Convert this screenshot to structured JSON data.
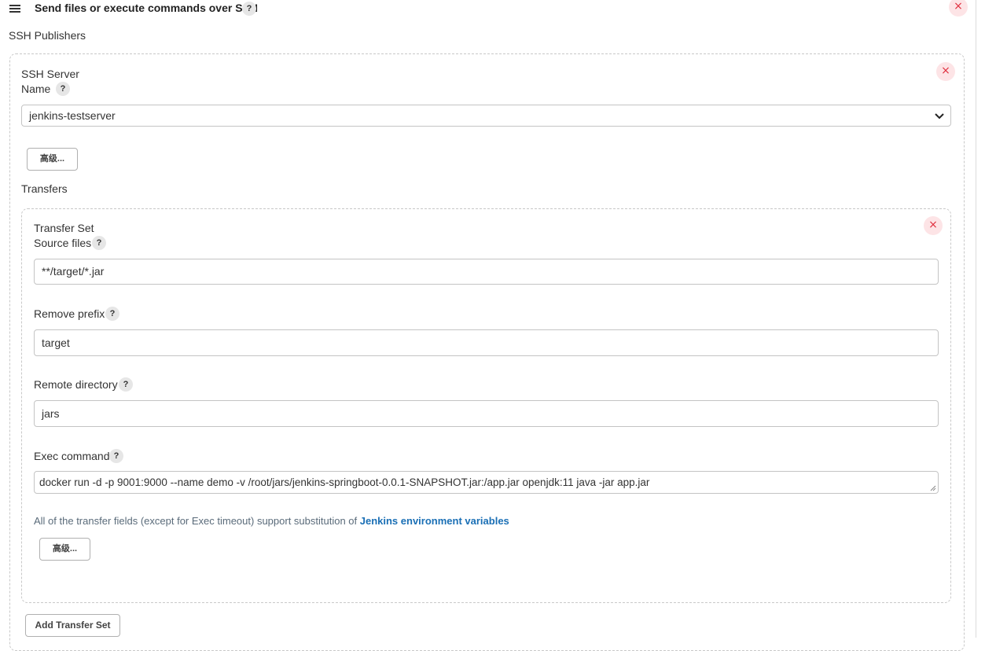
{
  "header": {
    "title": "Send files or execute commands over SSH",
    "help": "?",
    "close": "×"
  },
  "ssh_publishers": {
    "label": "SSH Publishers",
    "server": {
      "title": "SSH Server",
      "name_label": "Name",
      "help": "?",
      "close": "×",
      "selected": "jenkins-testserver",
      "advanced_label": "高级..."
    },
    "transfers_label": "Transfers",
    "transfer_set": {
      "title": "Transfer Set",
      "close": "×",
      "source_files_label": "Source files",
      "source_files_value": "**/target/*.jar",
      "remove_prefix_label": "Remove prefix",
      "remove_prefix_value": "target",
      "remote_directory_label": "Remote directory",
      "remote_directory_value": "jars",
      "exec_command_label": "Exec command",
      "exec_command_value": "docker run -d -p 9001:9000 --name demo -v /root/jars/jenkins-springboot-0.0.1-SNAPSHOT.jar:/app.jar openjdk:11 java -jar app.jar",
      "help": "?",
      "note_text": "All of the transfer fields (except for Exec timeout) support substitution of ",
      "note_link": "Jenkins environment variables",
      "advanced_label": "高级..."
    },
    "add_transfer_set_label": "Add Transfer Set"
  }
}
